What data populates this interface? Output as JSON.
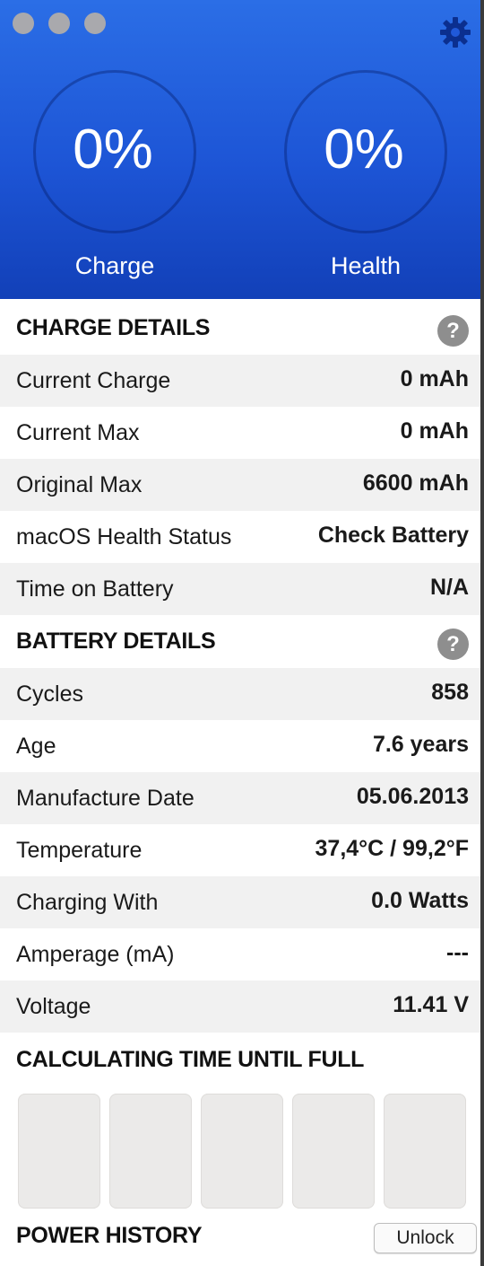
{
  "header": {
    "charge_percent": "0%",
    "charge_label": "Charge",
    "health_percent": "0%",
    "health_label": "Health",
    "gradient_top": "#2b6ee6",
    "gradient_bottom": "#1240b8"
  },
  "charge_details": {
    "title": "CHARGE DETAILS",
    "help": "?",
    "rows": [
      {
        "label": "Current Charge",
        "value": "0 mAh"
      },
      {
        "label": "Current Max",
        "value": "0 mAh"
      },
      {
        "label": "Original Max",
        "value": "6600 mAh"
      },
      {
        "label": "macOS Health Status",
        "value": "Check Battery"
      },
      {
        "label": "Time on Battery",
        "value": "N/A"
      }
    ]
  },
  "battery_details": {
    "title": "BATTERY DETAILS",
    "help": "?",
    "rows": [
      {
        "label": "Cycles",
        "value": "858"
      },
      {
        "label": "Age",
        "value": "7.6 years"
      },
      {
        "label": "Manufacture Date",
        "value": "05.06.2013"
      },
      {
        "label": "Temperature",
        "value": "37,4°C / 99,2°F"
      },
      {
        "label": "Charging With",
        "value": "0.0 Watts"
      },
      {
        "label": "Amperage (mA)",
        "value": "---"
      },
      {
        "label": "Voltage",
        "value": "11.41 V"
      }
    ]
  },
  "calculating": {
    "title": "CALCULATING TIME UNTIL FULL"
  },
  "power_history": {
    "title": "POWER HISTORY",
    "unlock_label": "Unlock"
  },
  "icons": {
    "gear": "gear-icon",
    "help": "help-icon"
  }
}
